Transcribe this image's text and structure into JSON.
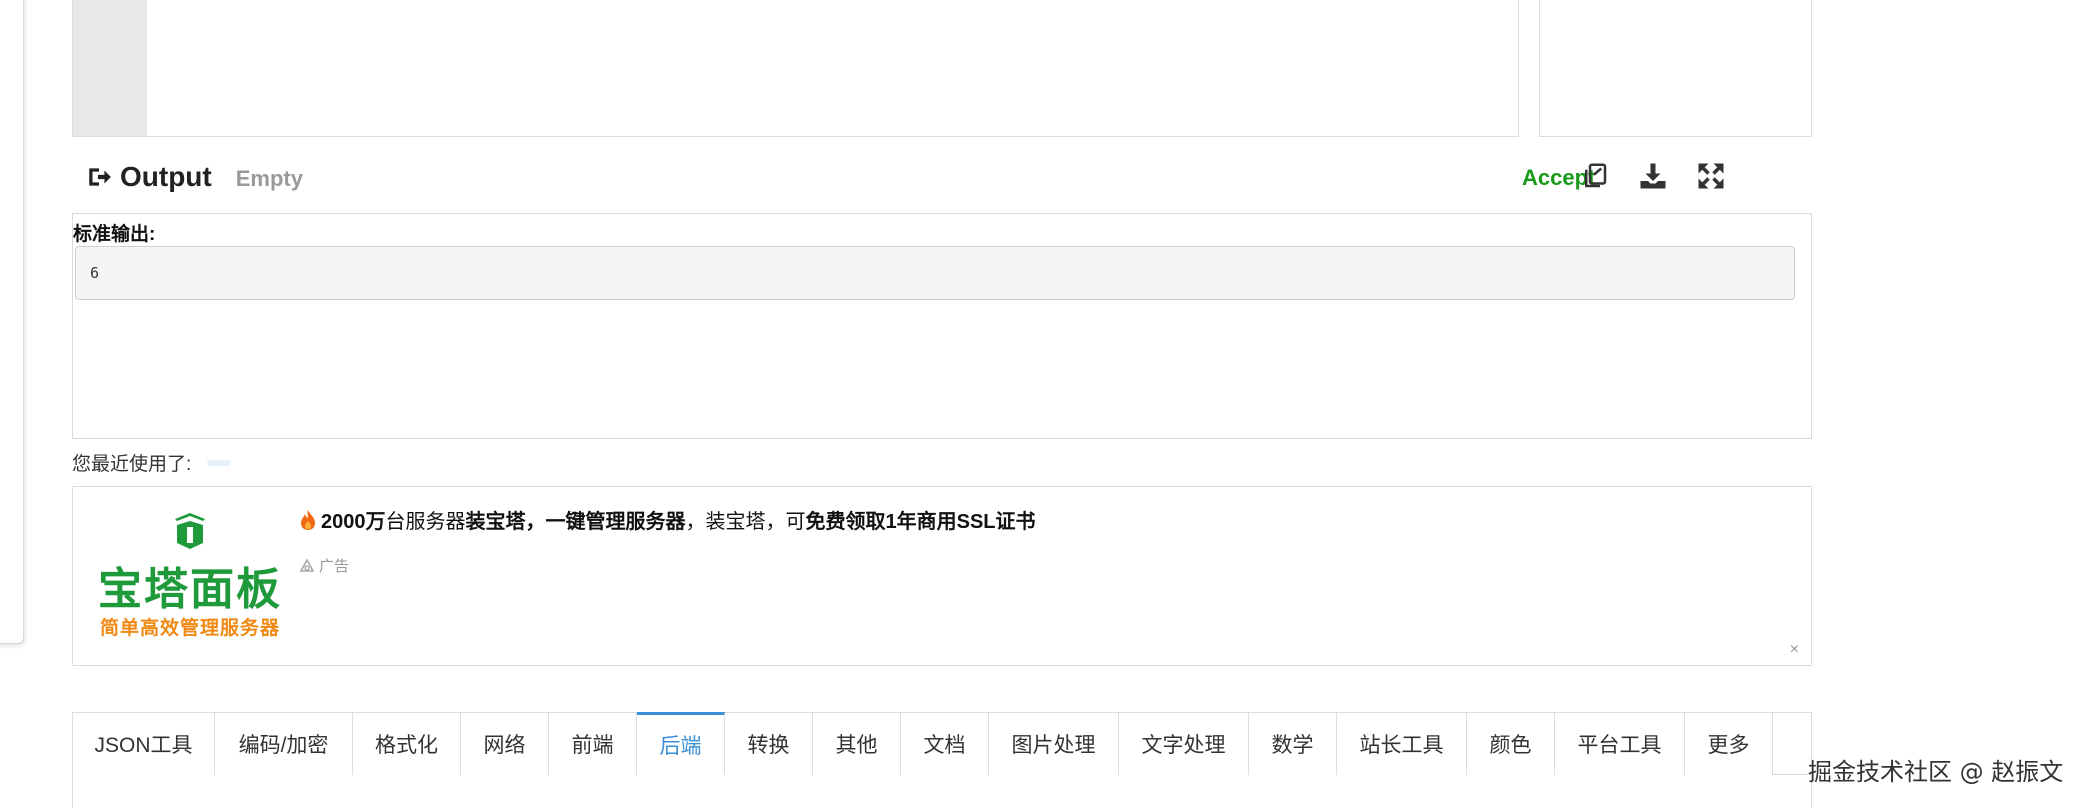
{
  "output": {
    "title": "Output",
    "state": "Empty",
    "accept_label": "Accept",
    "stdout_label": "标准输出:",
    "stdout_value": "6"
  },
  "recent": {
    "label": "您最近使用了:"
  },
  "ad": {
    "logo_title": "宝塔面板",
    "logo_subtitle": "简单高效管理服务器",
    "text_part1": "2000万",
    "text_part2": "台服务器",
    "text_part3": "装宝塔，一键管理服务器",
    "text_part4": "，装宝塔，可",
    "text_part5": "免费领取1年商用SSL证书",
    "tag": "广告",
    "close": "×"
  },
  "tabs": [
    {
      "label": "JSON工具",
      "width": 142
    },
    {
      "label": "编码/加密",
      "width": 138
    },
    {
      "label": "格式化",
      "width": 108
    },
    {
      "label": "网络",
      "width": 88
    },
    {
      "label": "前端",
      "width": 88
    },
    {
      "label": "后端",
      "width": 88,
      "active": true
    },
    {
      "label": "转换",
      "width": 88
    },
    {
      "label": "其他",
      "width": 88
    },
    {
      "label": "文档",
      "width": 88
    },
    {
      "label": "图片处理",
      "width": 130
    },
    {
      "label": "文字处理",
      "width": 130
    },
    {
      "label": "数学",
      "width": 88
    },
    {
      "label": "站长工具",
      "width": 130
    },
    {
      "label": "颜色",
      "width": 88
    },
    {
      "label": "平台工具",
      "width": 130
    },
    {
      "label": "更多",
      "width": 88
    }
  ],
  "watermark": "掘金技术社区 @ 赵振文",
  "colors": {
    "accent_green": "#1a9a1a",
    "tab_active": "#3a8fd6",
    "brand_green": "#1f9a3a",
    "brand_orange": "#f08a14"
  },
  "icons": [
    "sign-out-icon",
    "copy-icon",
    "download-icon",
    "expand-icon",
    "fire-icon",
    "ad-tag-icon",
    "bt-logo-icon"
  ]
}
